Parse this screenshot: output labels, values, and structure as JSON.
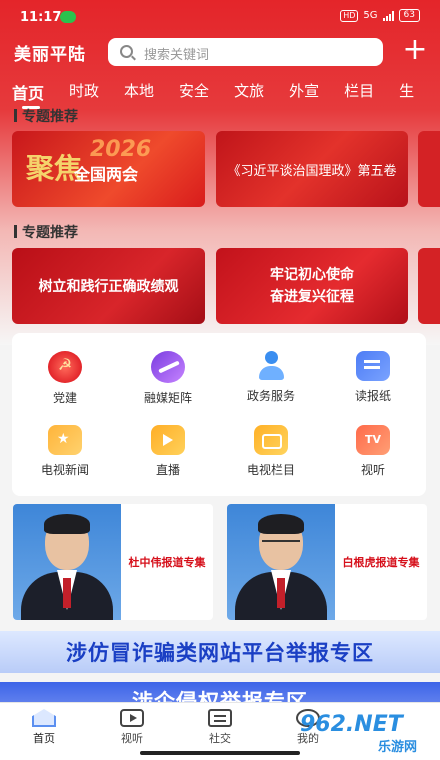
{
  "status": {
    "time": "11:17",
    "network": "5G",
    "hd": "HD",
    "battery": "63"
  },
  "header": {
    "logo": "美丽平陆",
    "search_placeholder": "搜索关键词",
    "add_label": "+"
  },
  "tabs": [
    "首页",
    "时政",
    "本地",
    "安全",
    "文旅",
    "外宣",
    "栏目",
    "生"
  ],
  "sections": {
    "first": "专题推荐",
    "second": "专题推荐"
  },
  "banners": {
    "row1": [
      {
        "line1": "聚焦",
        "line2": "全国两会",
        "year": "2026"
      },
      {
        "text": "《习近平谈治国理政》第五卷"
      }
    ],
    "row2": [
      {
        "text": "树立和践行正确政绩观"
      },
      {
        "line1": "牢记初心使命",
        "line2": "奋进复兴征程"
      }
    ]
  },
  "services": [
    {
      "label": "党建",
      "icon": "party-icon"
    },
    {
      "label": "融媒矩阵",
      "icon": "media-matrix-icon"
    },
    {
      "label": "政务服务",
      "icon": "government-service-icon"
    },
    {
      "label": "读报纸",
      "icon": "newspaper-icon"
    },
    {
      "label": "电视新闻",
      "icon": "tv-news-icon"
    },
    {
      "label": "直播",
      "icon": "live-icon"
    },
    {
      "label": "电视栏目",
      "icon": "tv-column-icon"
    },
    {
      "label": "视听",
      "icon": "audiovisual-icon"
    }
  ],
  "reports": [
    {
      "caption": "杜中伟报道专集"
    },
    {
      "caption": "白根虎报道专集"
    }
  ],
  "report_banner": "涉仿冒诈骗类网站平台举报专区",
  "report_banner2": "涉企侵权举报专区",
  "bottom_nav": [
    "首页",
    "视听",
    "社交",
    "我的"
  ],
  "watermark": {
    "brand": "962.NET",
    "sub": "乐游网"
  },
  "colors": {
    "brand_red": "#e4252a",
    "report_blue": "#1a3fc4",
    "caption_red": "#d6101b"
  }
}
